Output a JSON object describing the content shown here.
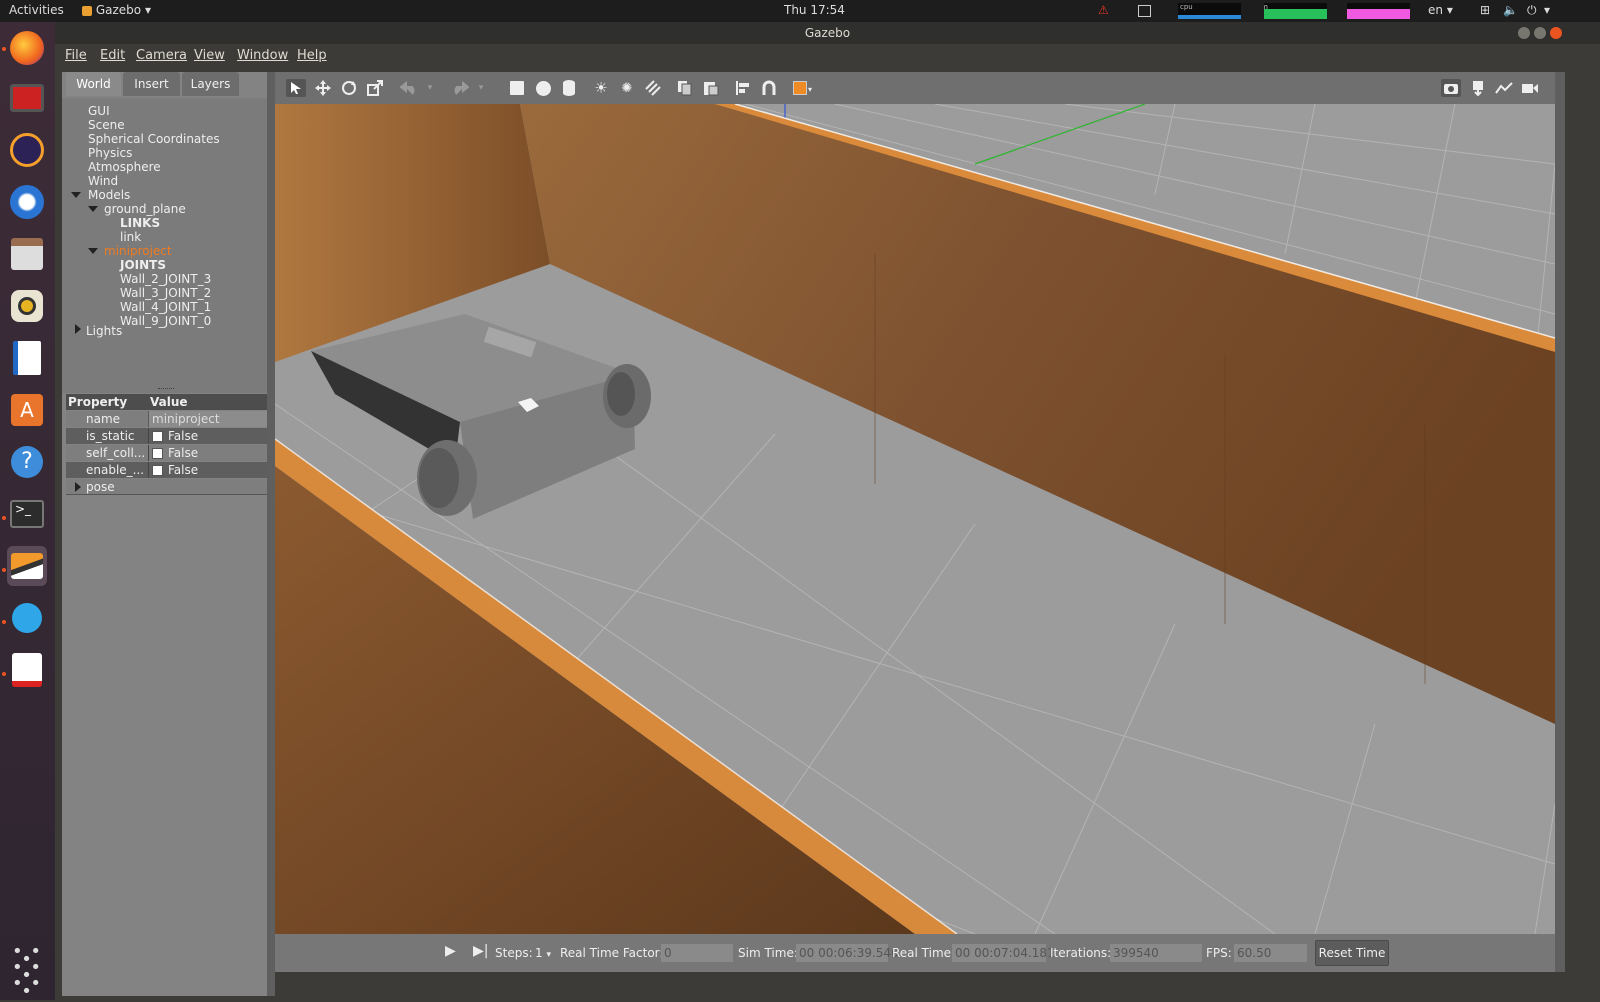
{
  "topbar": {
    "activities": "Activities",
    "app_name": "Gazebo",
    "clock": "Thu 17:54",
    "monitors": {
      "cpu": "cpu",
      "mem": "mem",
      "net": "net"
    },
    "language": "en"
  },
  "window": {
    "title": "Gazebo"
  },
  "menu": [
    "File",
    "Edit",
    "Camera",
    "View",
    "Window",
    "Help"
  ],
  "left_tabs": [
    "World",
    "Insert",
    "Layers"
  ],
  "tree": {
    "gui": "GUI",
    "scene": "Scene",
    "spherical": "Spherical Coordinates",
    "physics": "Physics",
    "atmosphere": "Atmosphere",
    "wind": "Wind",
    "models": "Models",
    "ground_plane": "ground_plane",
    "links_header": "LINKS",
    "link": "link",
    "miniproject": "miniproject",
    "joints_header": "JOINTS",
    "joints": [
      "Wall_2_JOINT_3",
      "Wall_3_JOINT_2",
      "Wall_4_JOINT_1",
      "Wall_9_JOINT_0"
    ],
    "lights": "Lights"
  },
  "properties": {
    "header_property": "Property",
    "header_value": "Value",
    "rows": [
      {
        "name": "name",
        "value": "miniproject"
      },
      {
        "name": "is_static",
        "value": "False"
      },
      {
        "name": "self_coll...",
        "value": "False"
      },
      {
        "name": "enable_...",
        "value": "False"
      }
    ],
    "pose": "pose"
  },
  "status": {
    "steps_label": "Steps:",
    "steps_value": "1",
    "rtf_label": "Real Time Factor:",
    "rtf_value": "0",
    "sim_time_label": "Sim Time:",
    "sim_time_value": "00 00:06:39.540",
    "real_time_label": "Real Time:",
    "real_time_value": "00 00:07:04.181",
    "iterations_label": "Iterations:",
    "iterations_value": "399540",
    "fps_label": "FPS:",
    "fps_value": "60.50",
    "reset_label": "Reset Time"
  },
  "colors": {
    "accent_orange": "#e95420",
    "selected_model": "#f07b1f",
    "wood": "#8a5a30",
    "ground": "#9a9a9a"
  }
}
